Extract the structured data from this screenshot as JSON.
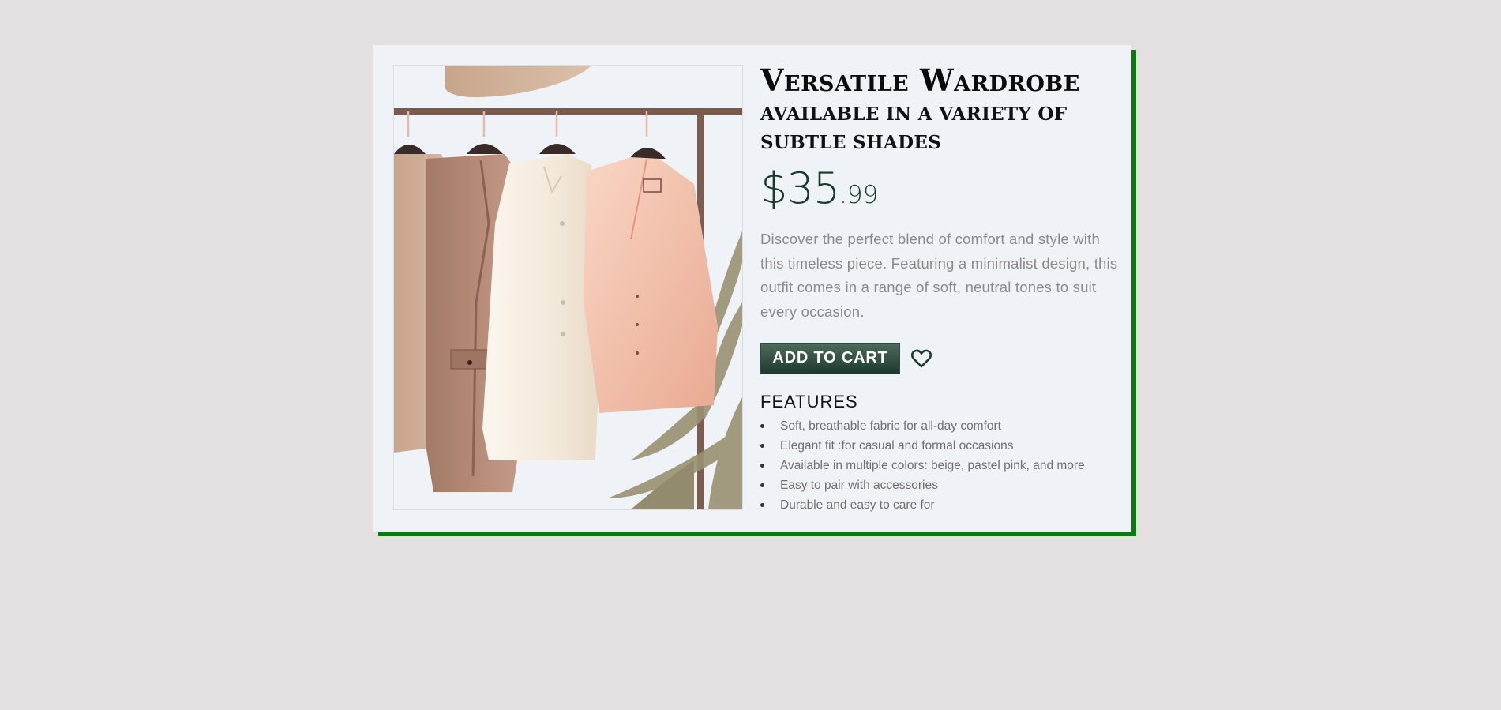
{
  "product": {
    "title": "Versatile Wardrobe",
    "subtitle": "Available in a variety of subtle shades",
    "price_main": "$35",
    "price_cents": ".99",
    "description": "Discover the perfect blend of comfort and style with this timeless piece. Featuring a minimalist design, this outfit comes in a range of soft, neutral tones to suit every occasion.",
    "add_to_cart_label": "ADD TO CART",
    "wishlist_icon": "heart-outline-icon",
    "image_subject": "clothing-rack-illustration"
  },
  "features": {
    "title": "FEATURES",
    "items": [
      "Soft, breathable fabric for all-day comfort",
      "Elegant fit :for casual and formal occasions",
      "Available in multiple colors: beige, pastel pink, and more",
      "Easy to pair with accessories",
      "Durable and easy to care for"
    ]
  },
  "colors": {
    "page_background": "#e4e0e1",
    "card_background": "#eff3f8",
    "card_shadow": "#0a7a12",
    "accent": "#1d3a2c",
    "price": "#183a2a"
  }
}
